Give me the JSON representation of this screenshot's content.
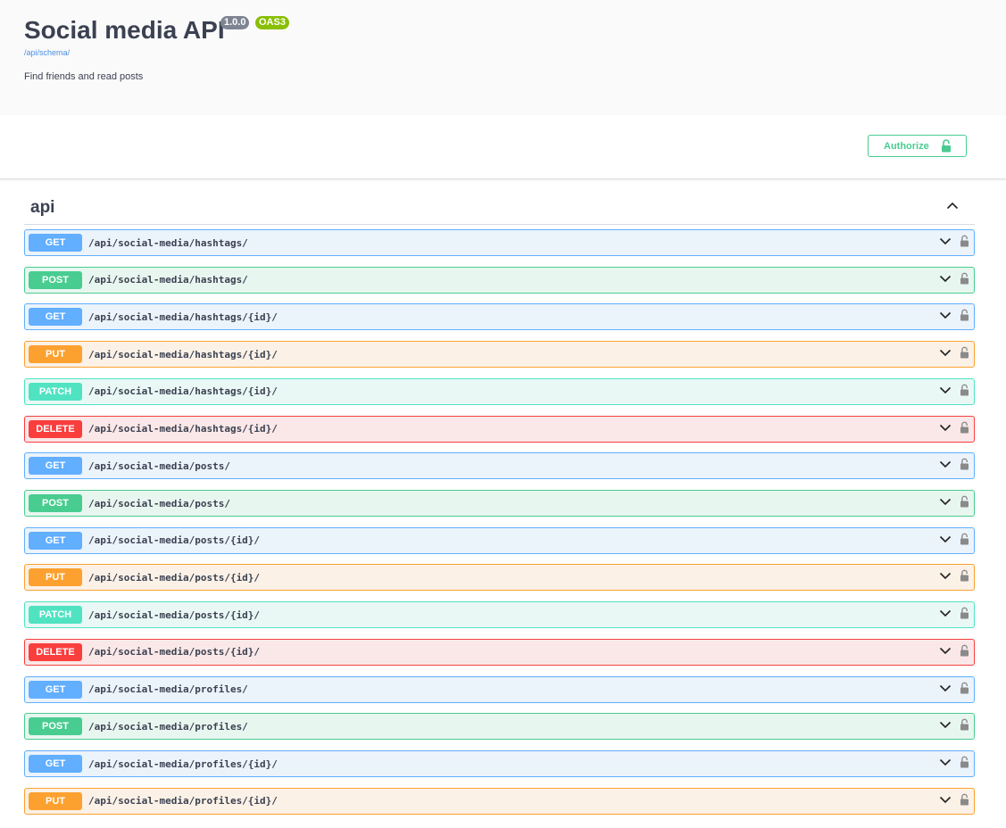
{
  "info": {
    "title": "Social media API",
    "version": "1.0.0",
    "oas": "OAS3",
    "schema_link": "/api/schema/",
    "description": "Find friends and read posts"
  },
  "scheme": {
    "authorize_label": "Authorize"
  },
  "tag": {
    "name": "api"
  },
  "operations": [
    {
      "method": "GET",
      "path": "/api/social-media/hashtags/"
    },
    {
      "method": "POST",
      "path": "/api/social-media/hashtags/"
    },
    {
      "method": "GET",
      "path": "/api/social-media/hashtags/{id}/"
    },
    {
      "method": "PUT",
      "path": "/api/social-media/hashtags/{id}/"
    },
    {
      "method": "PATCH",
      "path": "/api/social-media/hashtags/{id}/"
    },
    {
      "method": "DELETE",
      "path": "/api/social-media/hashtags/{id}/"
    },
    {
      "method": "GET",
      "path": "/api/social-media/posts/"
    },
    {
      "method": "POST",
      "path": "/api/social-media/posts/"
    },
    {
      "method": "GET",
      "path": "/api/social-media/posts/{id}/"
    },
    {
      "method": "PUT",
      "path": "/api/social-media/posts/{id}/"
    },
    {
      "method": "PATCH",
      "path": "/api/social-media/posts/{id}/"
    },
    {
      "method": "DELETE",
      "path": "/api/social-media/posts/{id}/"
    },
    {
      "method": "GET",
      "path": "/api/social-media/profiles/"
    },
    {
      "method": "POST",
      "path": "/api/social-media/profiles/"
    },
    {
      "method": "GET",
      "path": "/api/social-media/profiles/{id}/"
    },
    {
      "method": "PUT",
      "path": "/api/social-media/profiles/{id}/"
    }
  ],
  "icons": {
    "lock": "lock-icon",
    "expand": "chevron-down-icon",
    "collapse": "chevron-up-icon"
  },
  "colors": {
    "GET": "#61affe",
    "POST": "#49cc90",
    "PUT": "#fca130",
    "PATCH": "#50e3c2",
    "DELETE": "#f93e3e",
    "authorize": "#49cc90"
  }
}
